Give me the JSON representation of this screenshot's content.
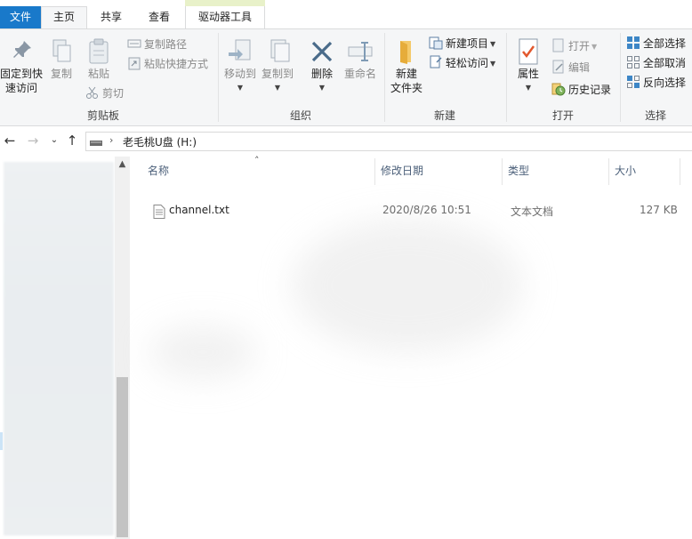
{
  "tabs": {
    "file": "文件",
    "home": "主页",
    "share": "共享",
    "view": "查看",
    "drive_tools": "驱动器工具"
  },
  "ribbon": {
    "clipboard": {
      "pin": "固定到快\n速访问",
      "copy": "复制",
      "paste": "粘贴",
      "copy_path": "复制路径",
      "paste_shortcut": "粘贴快捷方式",
      "cut": "剪切",
      "group": "剪贴板"
    },
    "organize": {
      "move_to": "移动到",
      "copy_to": "复制到",
      "delete": "删除",
      "rename": "重命名",
      "group": "组织"
    },
    "new": {
      "new_folder": "新建\n文件夹",
      "new_item": "新建项目",
      "easy_access": "轻松访问",
      "group": "新建"
    },
    "open": {
      "properties": "属性",
      "open": "打开",
      "edit": "编辑",
      "history": "历史记录",
      "group": "打开"
    },
    "select": {
      "select_all": "全部选择",
      "select_none": "全部取消",
      "invert": "反向选择",
      "group": "选择"
    }
  },
  "address": {
    "path": "老毛桃U盘 (H:)"
  },
  "columns": {
    "name": "名称",
    "modified": "修改日期",
    "type": "类型",
    "size": "大小"
  },
  "files": [
    {
      "name": "channel.txt",
      "modified": "2020/8/26 10:51",
      "type": "文本文档",
      "size": "127 KB"
    }
  ],
  "colors": {
    "accent": "#1979ca",
    "ribbon_bg": "#f5f6f7",
    "header_text": "#4c607a",
    "context_tab": "#e8f1c9"
  }
}
